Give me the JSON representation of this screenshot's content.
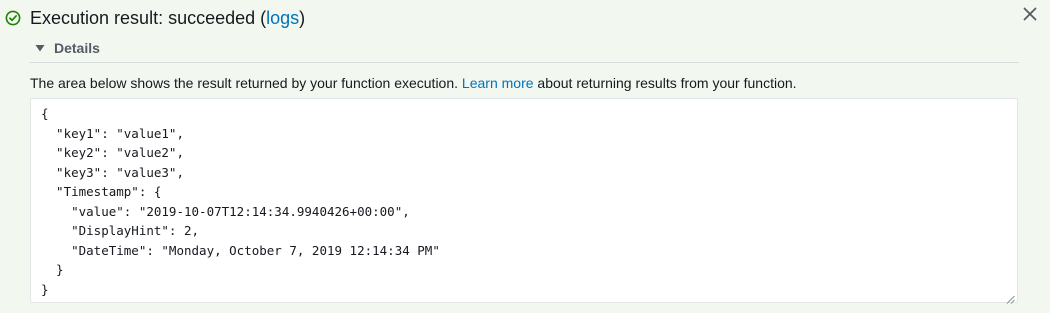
{
  "header": {
    "title_prefix": "Execution result: succeeded (",
    "logs_link": "logs",
    "title_suffix": ")",
    "status_color": "#1d8102",
    "icon": "check-circle-icon",
    "close_icon": "close-icon"
  },
  "details": {
    "label": "Details",
    "caret_icon": "caret-down-icon"
  },
  "description": {
    "before": "The area below shows the result returned by your function execution. ",
    "link": "Learn more",
    "after": " about returning results from your function."
  },
  "result": {
    "text": "{\n  \"key1\": \"value1\",\n  \"key2\": \"value2\",\n  \"key3\": \"value3\",\n  \"Timestamp\": {\n    \"value\": \"2019-10-07T12:14:34.9940426+00:00\",\n    \"DisplayHint\": 2,\n    \"DateTime\": \"Monday, October 7, 2019 12:14:34 PM\"\n  }\n}"
  },
  "colors": {
    "background": "#f2f8f0",
    "link": "#0073bb"
  }
}
